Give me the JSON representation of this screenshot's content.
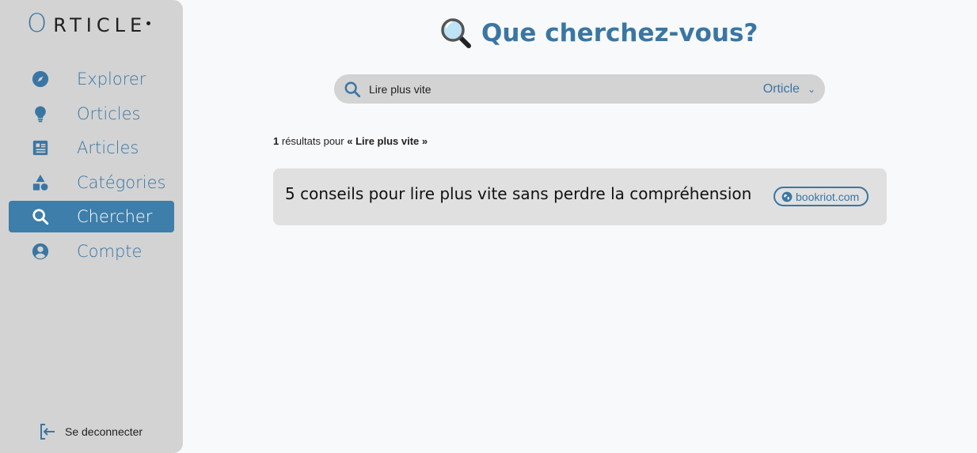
{
  "app": {
    "logo_o": "O",
    "logo_rest": "RTICLE"
  },
  "sidebar": {
    "items": [
      {
        "label": "Explorer",
        "icon": "compass-icon"
      },
      {
        "label": "Orticles",
        "icon": "lightbulb-icon"
      },
      {
        "label": "Articles",
        "icon": "newspaper-icon"
      },
      {
        "label": "Catégories",
        "icon": "shapes-icon"
      },
      {
        "label": "Chercher",
        "icon": "search-icon",
        "active": true
      },
      {
        "label": "Compte",
        "icon": "user-circle-icon"
      }
    ],
    "logout_label": "Se deconnecter"
  },
  "main": {
    "heading": "Que cherchez-vous?",
    "search": {
      "value": "Lire plus vite",
      "placeholder": ""
    },
    "scope": {
      "selected": "Orticle"
    },
    "results_summary": {
      "count": "1",
      "text": "résultats pour",
      "query": "« Lire plus vite »"
    },
    "results": [
      {
        "title": "5 conseils pour lire plus vite sans perdre la compréhension",
        "source": "bookriot.com"
      }
    ]
  },
  "colors": {
    "accent": "#3a76a3",
    "sidebar_bg": "#d3d3d3",
    "card_bg": "#e0e0e0",
    "active_bg": "#3d7eaa"
  }
}
